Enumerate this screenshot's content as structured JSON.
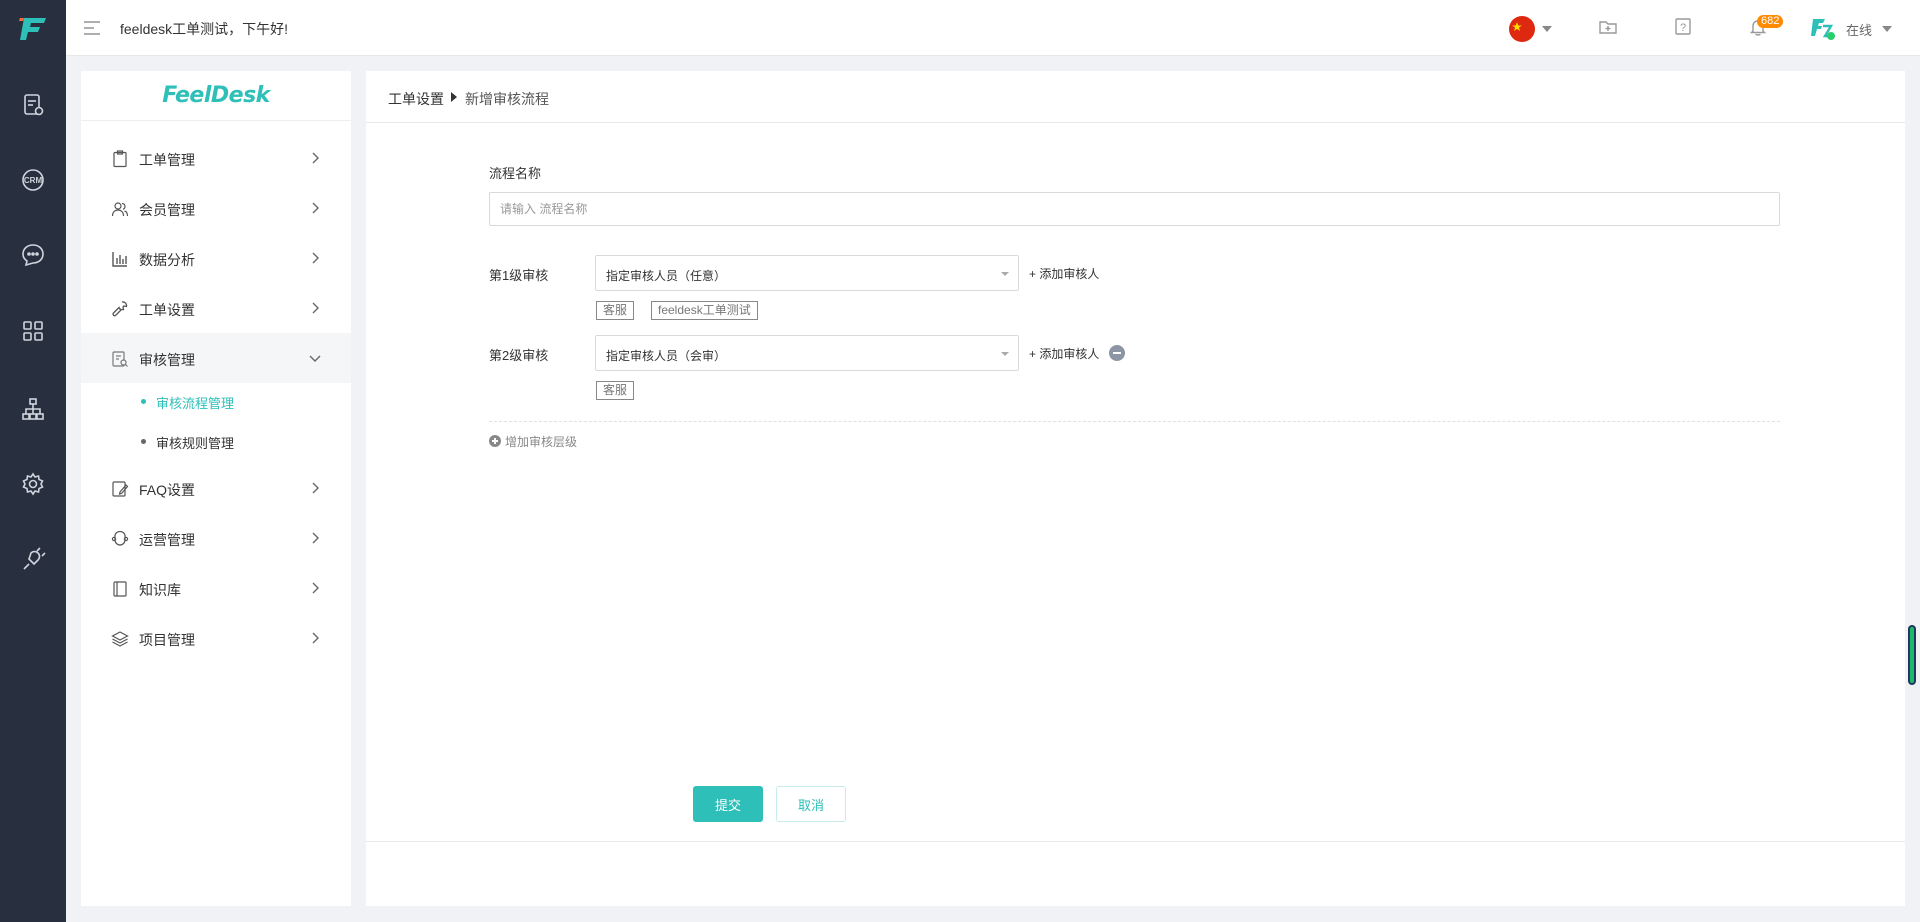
{
  "topbar": {
    "greeting": "feeldesk工单测试，下午好!",
    "notification_count": "682",
    "status": "在线"
  },
  "sidebar": {
    "logo_text": "FeelDesk",
    "items": [
      {
        "label": "工单管理"
      },
      {
        "label": "会员管理"
      },
      {
        "label": "数据分析"
      },
      {
        "label": "工单设置"
      },
      {
        "label": "审核管理"
      },
      {
        "label": "FAQ设置"
      },
      {
        "label": "运营管理"
      },
      {
        "label": "知识库"
      },
      {
        "label": "项目管理"
      }
    ],
    "subitems": [
      {
        "label": "审核流程管理",
        "active": true
      },
      {
        "label": "审核规则管理",
        "active": false
      }
    ]
  },
  "breadcrumb": {
    "parent": "工单设置",
    "current": "新增审核流程"
  },
  "form": {
    "name_label": "流程名称",
    "name_placeholder": "请输入 流程名称",
    "levels": [
      {
        "label": "第1级审核",
        "select_value": "指定审核人员（任意）",
        "add_label": "+ 添加审核人",
        "tags": [
          "客服",
          "feeldesk工单测试"
        ]
      },
      {
        "label": "第2级审核",
        "select_value": "指定审核人员（会审）",
        "add_label": "+ 添加审核人",
        "tags": [
          "客服"
        ]
      }
    ],
    "add_level_label": "增加审核层级"
  },
  "actions": {
    "submit": "提交",
    "cancel": "取消"
  },
  "colors": {
    "accent": "#2dbfb8",
    "rail_bg": "#283040",
    "badge": "#ff8a00"
  }
}
